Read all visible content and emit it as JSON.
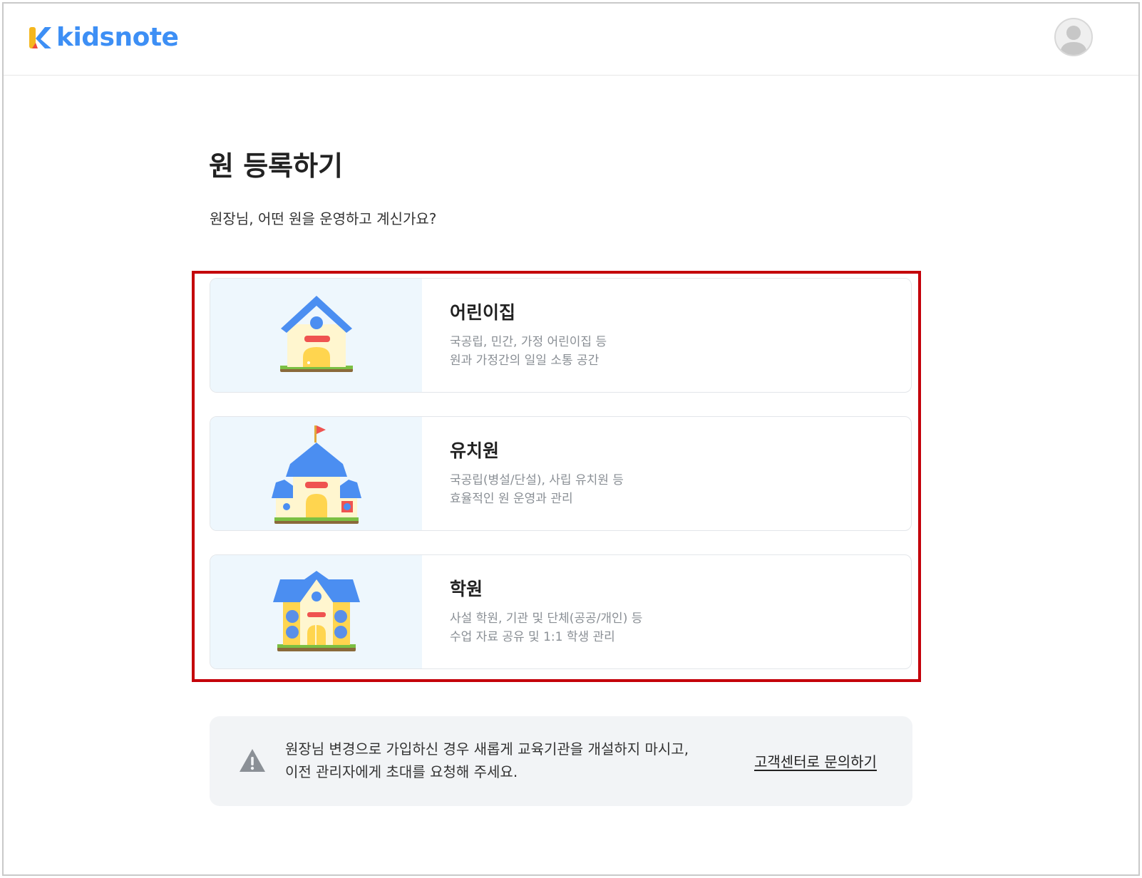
{
  "header": {
    "logo_text": "kidsnote",
    "avatar_icon": "user-avatar-icon"
  },
  "main": {
    "title": "원 등록하기",
    "subtitle": "원장님, 어떤 원을 운영하고 계신가요?"
  },
  "options": [
    {
      "title": "어린이집",
      "desc_line1": "국공립, 민간, 가정 어린이집 등",
      "desc_line2": "원과 가정간의 일일 소통 공간",
      "icon": "daycare-house-icon"
    },
    {
      "title": "유치원",
      "desc_line1": "국공립(병설/단설), 사립 유치원 등",
      "desc_line2": "효율적인 원 운영과 관리",
      "icon": "kindergarten-building-icon"
    },
    {
      "title": "학원",
      "desc_line1": "사설 학원, 기관 및 단체(공공/개인) 등",
      "desc_line2": "수업 자료 공유 및 1:1 학생 관리",
      "icon": "academy-building-icon"
    }
  ],
  "notice": {
    "line1": "원장님 변경으로 가입하신 경우 새롭게 교육기관을 개설하지 마시고,",
    "line2": "이전 관리자에게 초대를 요청해 주세요.",
    "link_label": "고객센터로 문의하기",
    "icon": "warning-triangle-icon"
  },
  "colors": {
    "brand": "#3d8ff5",
    "highlight_border": "#c4000a",
    "thumb_bg": "#eef7fd",
    "notice_bg": "#f2f4f6"
  }
}
